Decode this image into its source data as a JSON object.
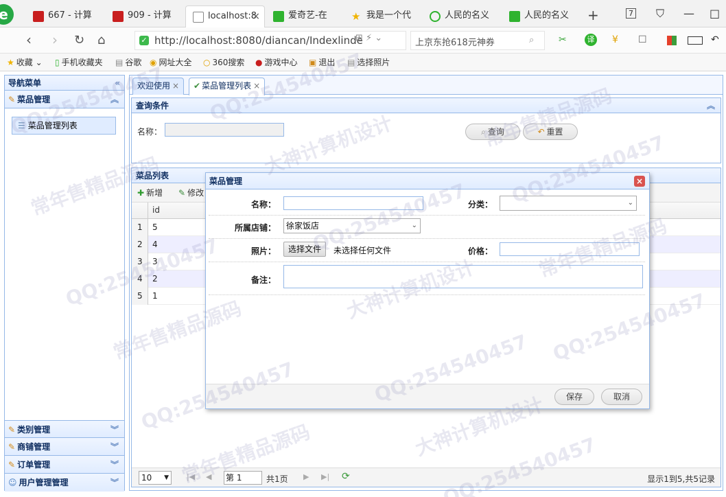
{
  "browser": {
    "tabs": [
      {
        "label": "667 - 计算",
        "fav_color": "#c81e1e"
      },
      {
        "label": "909 - 计算",
        "fav_color": "#c81e1e"
      },
      {
        "label": "localhost:8",
        "fav_color": "#ffffff"
      },
      {
        "label": "爱奇艺-在",
        "fav_color": "#2fb32f"
      },
      {
        "label": "我是一个代",
        "fav_color": "#f0b400"
      },
      {
        "label": "人民的名义",
        "fav_color": "#2fb32f"
      },
      {
        "label": "人民的名义",
        "fav_color": "#2fb32f"
      }
    ],
    "tab_count_badge": "7",
    "url": "http://localhost:8080/diancan/Indexlinde",
    "search_text": "上京东抢618元神券"
  },
  "bookmarks": [
    {
      "label": "收藏",
      "icon": "star-icon"
    },
    {
      "label": "手机收藏夹",
      "icon": "phone-icon"
    },
    {
      "label": "谷歌",
      "icon": "page-icon"
    },
    {
      "label": "网址大全",
      "icon": "globe-icon"
    },
    {
      "label": "360搜索",
      "icon": "search-icon"
    },
    {
      "label": "游戏中心",
      "icon": "game-icon"
    },
    {
      "label": "退出",
      "icon": "exit-icon"
    },
    {
      "label": "选择照片",
      "icon": "page-icon"
    }
  ],
  "sidebar": {
    "title": "导航菜单",
    "sections": [
      {
        "label": "菜品管理",
        "expanded": true,
        "items": [
          {
            "label": "菜品管理列表"
          }
        ]
      },
      {
        "label": "类别管理",
        "expanded": false
      },
      {
        "label": "商铺管理",
        "expanded": false
      },
      {
        "label": "订单管理",
        "expanded": false
      },
      {
        "label": "用户管理管理",
        "expanded": false
      }
    ]
  },
  "main": {
    "tabs": [
      {
        "label": "欢迎使用"
      },
      {
        "label": "菜品管理列表",
        "selected": true
      }
    ],
    "query": {
      "title": "查询条件",
      "name_label": "名称：",
      "search_button": "查询",
      "reset_button": "重置"
    },
    "list": {
      "title": "菜品列表",
      "add_button": "新增",
      "edit_button": "修改",
      "column_header": "id",
      "rows": [
        {
          "rownum": "1",
          "id": "5"
        },
        {
          "rownum": "2",
          "id": "4"
        },
        {
          "rownum": "3",
          "id": "3"
        },
        {
          "rownum": "4",
          "id": "2"
        },
        {
          "rownum": "5",
          "id": "1"
        }
      ]
    },
    "pager": {
      "page_size": "10",
      "page_prefix": "第",
      "page_number": "1",
      "page_total": "共1页",
      "summary": "显示1到5,共5记录"
    }
  },
  "dialog": {
    "title": "菜品管理",
    "name_label": "名称：",
    "category_label": "分类：",
    "shop_label": "所属店铺：",
    "shop_value": "徐家饭店",
    "photo_label": "照片：",
    "file_button": "选择文件",
    "file_status": "未选择任何文件",
    "price_label": "价格：",
    "remark_label": "备注：",
    "save_button": "保存",
    "cancel_button": "取消"
  },
  "watermark": {
    "qq": "QQ:254540457",
    "a": "常年售精品源码",
    "b": "大神计算机设计"
  },
  "colors": {
    "panel_border": "#95b8e7",
    "panel_header": "#e0ecff",
    "title_text": "#0e2d5f",
    "browser_accent": "#27a845"
  }
}
